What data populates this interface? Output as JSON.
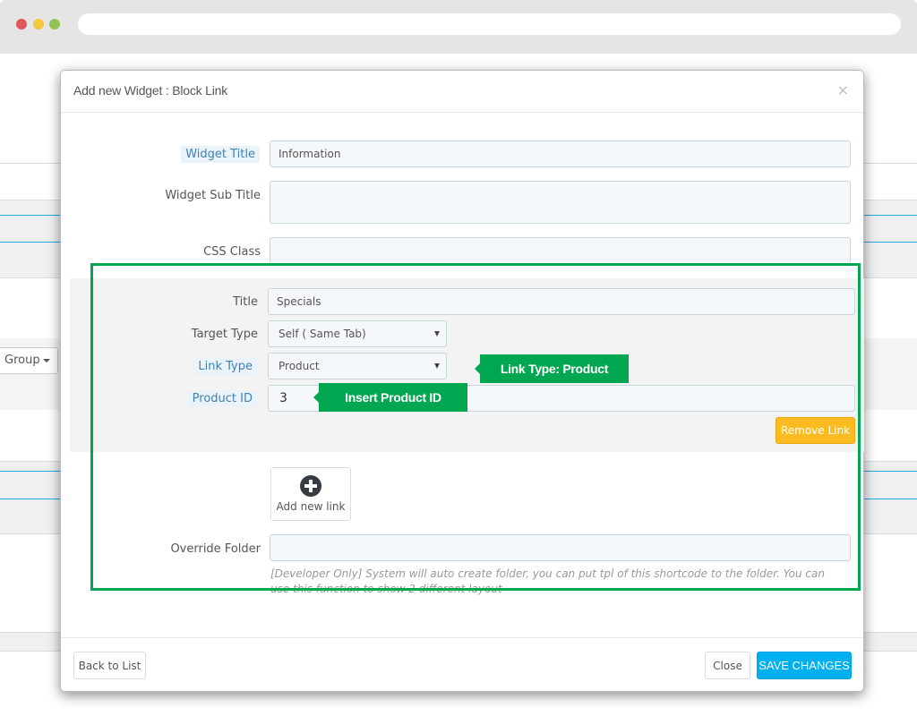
{
  "browser": {
    "traffic_lights": [
      "close",
      "minimize",
      "maximize"
    ]
  },
  "background": {
    "group_button_label": "Group"
  },
  "modal": {
    "title": "Add new Widget : Block Link",
    "close_icon": "×",
    "fields": {
      "widget_title": {
        "label": "Widget Title",
        "value": "Information"
      },
      "widget_sub_title": {
        "label": "Widget Sub Title",
        "value": ""
      },
      "css_class": {
        "label": "CSS Class",
        "value": ""
      },
      "override_folder": {
        "label": "Override Folder",
        "value": "",
        "help": "[Developer Only] System will auto create folder, you can put tpl of this shortcode to the folder. You can use this function to show 2 different layout"
      }
    },
    "link": {
      "title": {
        "label": "Title",
        "value": "Specials"
      },
      "target_type": {
        "label": "Target Type",
        "value": "Self ( Same Tab)"
      },
      "link_type": {
        "label": "Link Type",
        "value": "Product"
      },
      "product_id": {
        "label": "Product ID",
        "value": "3"
      },
      "remove_label": "Remove Link"
    },
    "add_link_label": "Add new link",
    "callouts": {
      "link_type": "Link Type: Product",
      "product_id": "Insert Product ID"
    },
    "footer": {
      "back_label": "Back to List",
      "close_label": "Close",
      "save_label": "SAVE CHANGES"
    }
  },
  "colors": {
    "callout_green": "#00a650",
    "primary_blue": "#00aff0",
    "warning_yellow": "#fbbb21",
    "label_highlight": "#3d82b8"
  }
}
